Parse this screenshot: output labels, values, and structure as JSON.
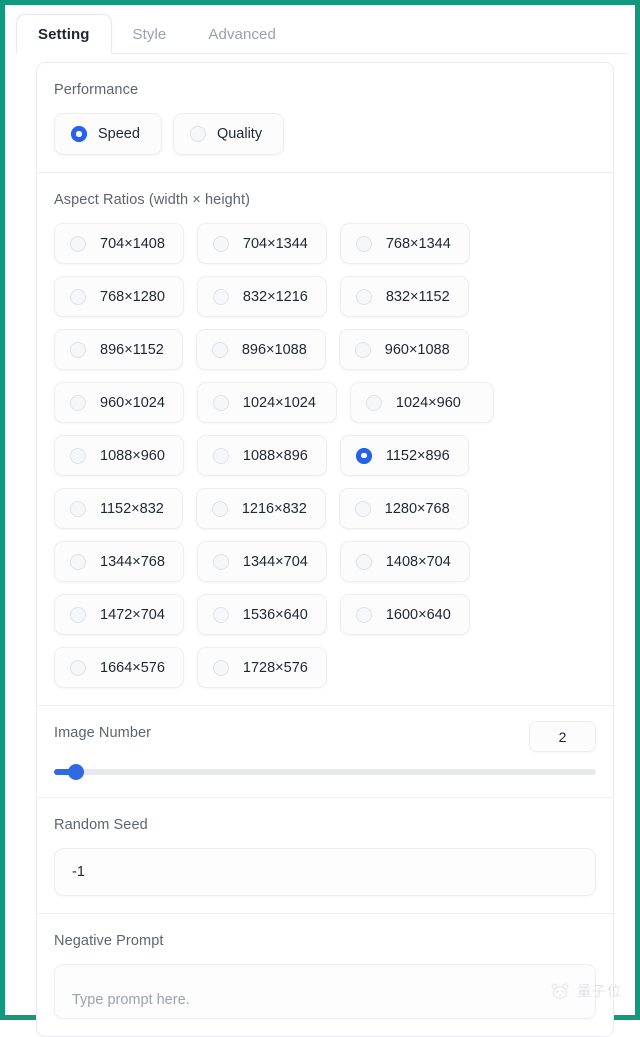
{
  "theme": {
    "frame_color": "#12987c",
    "accent_color": "#2563eb",
    "slider_color": "#2f6ae4",
    "panel_border": "#e9ebee",
    "muted_text": "#5d6470",
    "active_tab_text": "#1f2633",
    "inactive_tab_text": "#9aa1ae"
  },
  "tabs": [
    {
      "label": "Setting",
      "active": true
    },
    {
      "label": "Style",
      "active": false
    },
    {
      "label": "Advanced",
      "active": false
    }
  ],
  "performance": {
    "label": "Performance",
    "options": [
      {
        "label": "Speed",
        "selected": true
      },
      {
        "label": "Quality",
        "selected": false
      }
    ]
  },
  "aspect_ratios": {
    "label": "Aspect Ratios (width × height)",
    "selected": "1152×896",
    "options": [
      {
        "label": "704×1408",
        "selected": false,
        "size": "normal"
      },
      {
        "label": "704×1344",
        "selected": false,
        "size": "normal"
      },
      {
        "label": "768×1344",
        "selected": false,
        "size": "normal"
      },
      {
        "label": "768×1280",
        "selected": false,
        "size": "normal"
      },
      {
        "label": "832×1216",
        "selected": false,
        "size": "normal"
      },
      {
        "label": "832×1152",
        "selected": false,
        "size": "normal"
      },
      {
        "label": "896×1152",
        "selected": false,
        "size": "normal"
      },
      {
        "label": "896×1088",
        "selected": false,
        "size": "normal"
      },
      {
        "label": "960×1088",
        "selected": false,
        "size": "normal"
      },
      {
        "label": "960×1024",
        "selected": false,
        "size": "normal"
      },
      {
        "label": "1024×1024",
        "selected": false,
        "size": "wide"
      },
      {
        "label": "1024×960",
        "selected": false,
        "size": "xwide"
      },
      {
        "label": "1088×960",
        "selected": false,
        "size": "normal"
      },
      {
        "label": "1088×896",
        "selected": false,
        "size": "normal"
      },
      {
        "label": "1152×896",
        "selected": true,
        "size": "normal"
      },
      {
        "label": "1152×832",
        "selected": false,
        "size": "normal"
      },
      {
        "label": "1216×832",
        "selected": false,
        "size": "normal"
      },
      {
        "label": "1280×768",
        "selected": false,
        "size": "normal"
      },
      {
        "label": "1344×768",
        "selected": false,
        "size": "normal"
      },
      {
        "label": "1344×704",
        "selected": false,
        "size": "normal"
      },
      {
        "label": "1408×704",
        "selected": false,
        "size": "normal"
      },
      {
        "label": "1472×704",
        "selected": false,
        "size": "normal"
      },
      {
        "label": "1536×640",
        "selected": false,
        "size": "normal"
      },
      {
        "label": "1600×640",
        "selected": false,
        "size": "normal"
      },
      {
        "label": "1664×576",
        "selected": false,
        "size": "normal"
      },
      {
        "label": "1728×576",
        "selected": false,
        "size": "normal"
      }
    ]
  },
  "image_number": {
    "label": "Image Number",
    "value": "2",
    "fill_percent": 4
  },
  "random_seed": {
    "label": "Random Seed",
    "value": "-1"
  },
  "negative_prompt": {
    "label": "Negative Prompt",
    "value": "",
    "placeholder": "Type prompt here."
  },
  "watermark": {
    "text": "量子位",
    "icon": "panda-logo-icon"
  }
}
